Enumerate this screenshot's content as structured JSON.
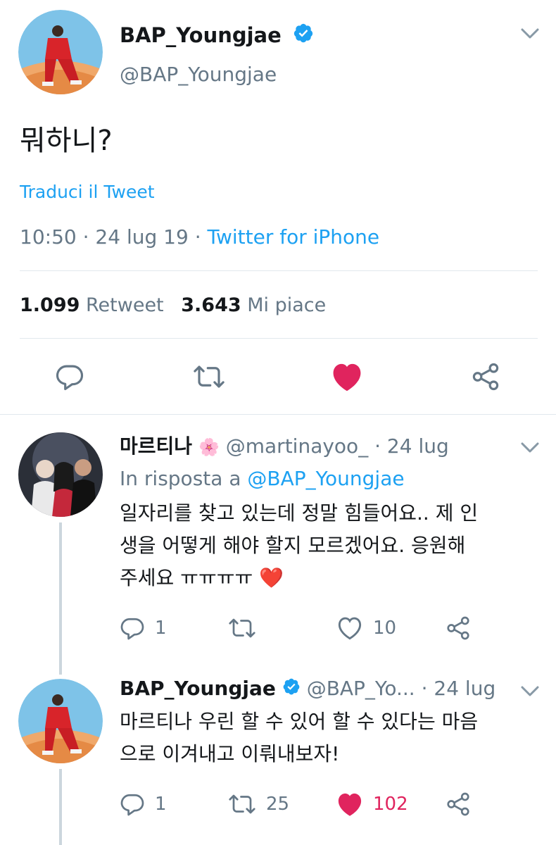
{
  "main_tweet": {
    "display_name": "BAP_Youngjae",
    "handle": "@BAP_Youngjae",
    "text": "뭐하니?",
    "translate_label": "Traduci il Tweet",
    "time": "10:50",
    "sep1": "·",
    "date": "24 lug 19",
    "sep2": "·",
    "source": "Twitter for iPhone",
    "retweets_count": "1.099",
    "retweets_label": "Retweet",
    "likes_count": "3.643",
    "likes_label": "Mi piace"
  },
  "reply1": {
    "display_name": "마르티나",
    "emoji": "🌸",
    "handle": "@martinayoo_",
    "sep": "·",
    "date": "24 lug",
    "reply_prefix": "In risposta a",
    "reply_to": "@BAP_Youngjae",
    "text_line1": "일자리를 찾고 있는데 정말 힘들어요.. 제 인",
    "text_line2": "생을 어떻게 해야 할지 모르겠어요. 응원해",
    "text_line3": "주세요 ㅠㅠㅠㅠ",
    "heart_emoji": "❤️",
    "reply_count": "1",
    "like_count": "10"
  },
  "reply2": {
    "display_name": "BAP_Youngjae",
    "handle": "@BAP_Yo...",
    "sep": "·",
    "date": "24 lug",
    "text_line1": "마르티나 우린 할 수 있어 할 수 있다는 마음",
    "text_line2": "으로 이겨내고 이뤄내보자!",
    "reply_count": "1",
    "retweet_count": "25",
    "like_count": "102"
  },
  "colors": {
    "accent": "#1da1f2",
    "like": "#e0245e",
    "muted": "#657786",
    "text": "#14171a"
  }
}
